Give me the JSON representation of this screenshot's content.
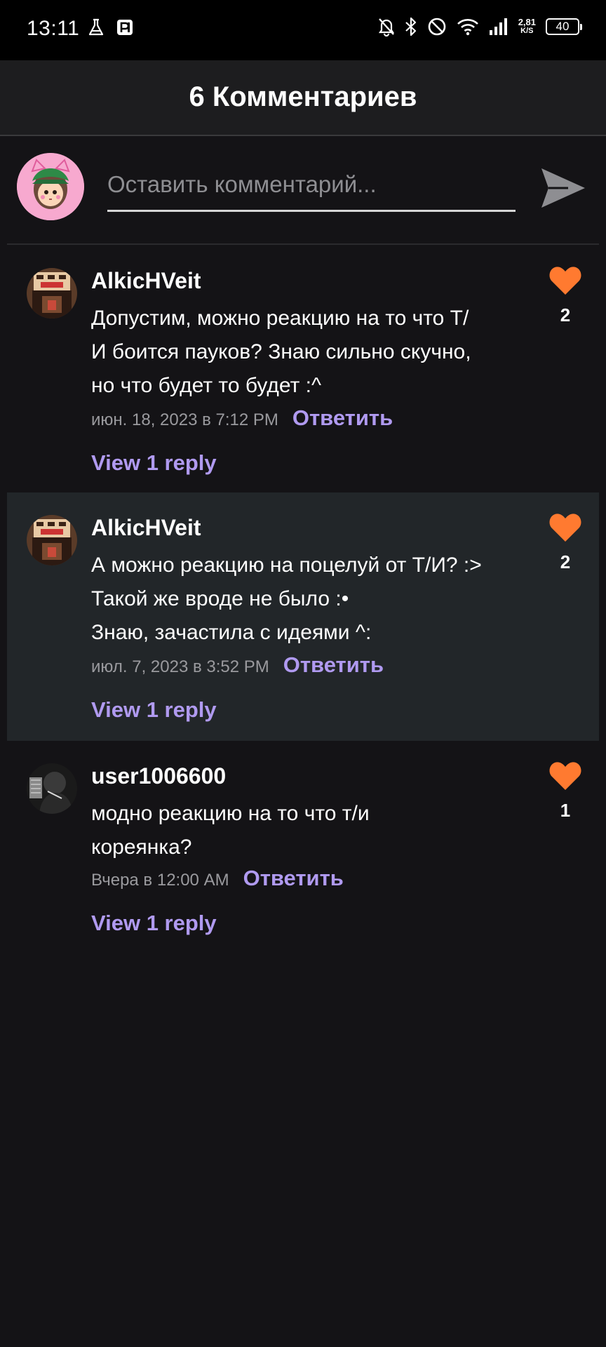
{
  "status_bar": {
    "time": "13:11",
    "net_speed_value": "2,81",
    "net_speed_unit": "K/S",
    "battery": "40"
  },
  "header": {
    "title": "6 Комментариев"
  },
  "composer": {
    "placeholder": "Оставить комментарий..."
  },
  "colors": {
    "accent": "#b09af0",
    "like": "#ff7a30",
    "background": "#141316",
    "highlight_row": "#222629"
  },
  "comments": [
    {
      "author": "AlkicHVeit",
      "lines": [
        "Допустим, можно реакцию на то что Т/",
        "И боится пауков? Знаю сильно скучно,",
        "но что будет то будет :^"
      ],
      "date": "июн. 18, 2023 в 7:12 PM",
      "reply_label": "Ответить",
      "view_replies": "View 1 reply",
      "likes": "2",
      "like_icon": "heart-icon"
    },
    {
      "author": "AlkicHVeit",
      "lines": [
        "А можно реакцию на поцелуй от Т/И? :>",
        "Такой же вроде не было :•",
        "Знаю, зачастила с идеями ^:"
      ],
      "date": "июл. 7, 2023 в 3:52 PM",
      "reply_label": "Ответить",
      "view_replies": "View 1 reply",
      "likes": "2",
      "like_icon": "heart-icon"
    },
    {
      "author": "user1006600",
      "lines": [
        "модно реакцию на то что т/и",
        "кореянка?"
      ],
      "date": "Вчера в 12:00 AM",
      "reply_label": "Ответить",
      "view_replies": "View 1 reply",
      "likes": "1",
      "like_icon": "heart-icon"
    }
  ]
}
